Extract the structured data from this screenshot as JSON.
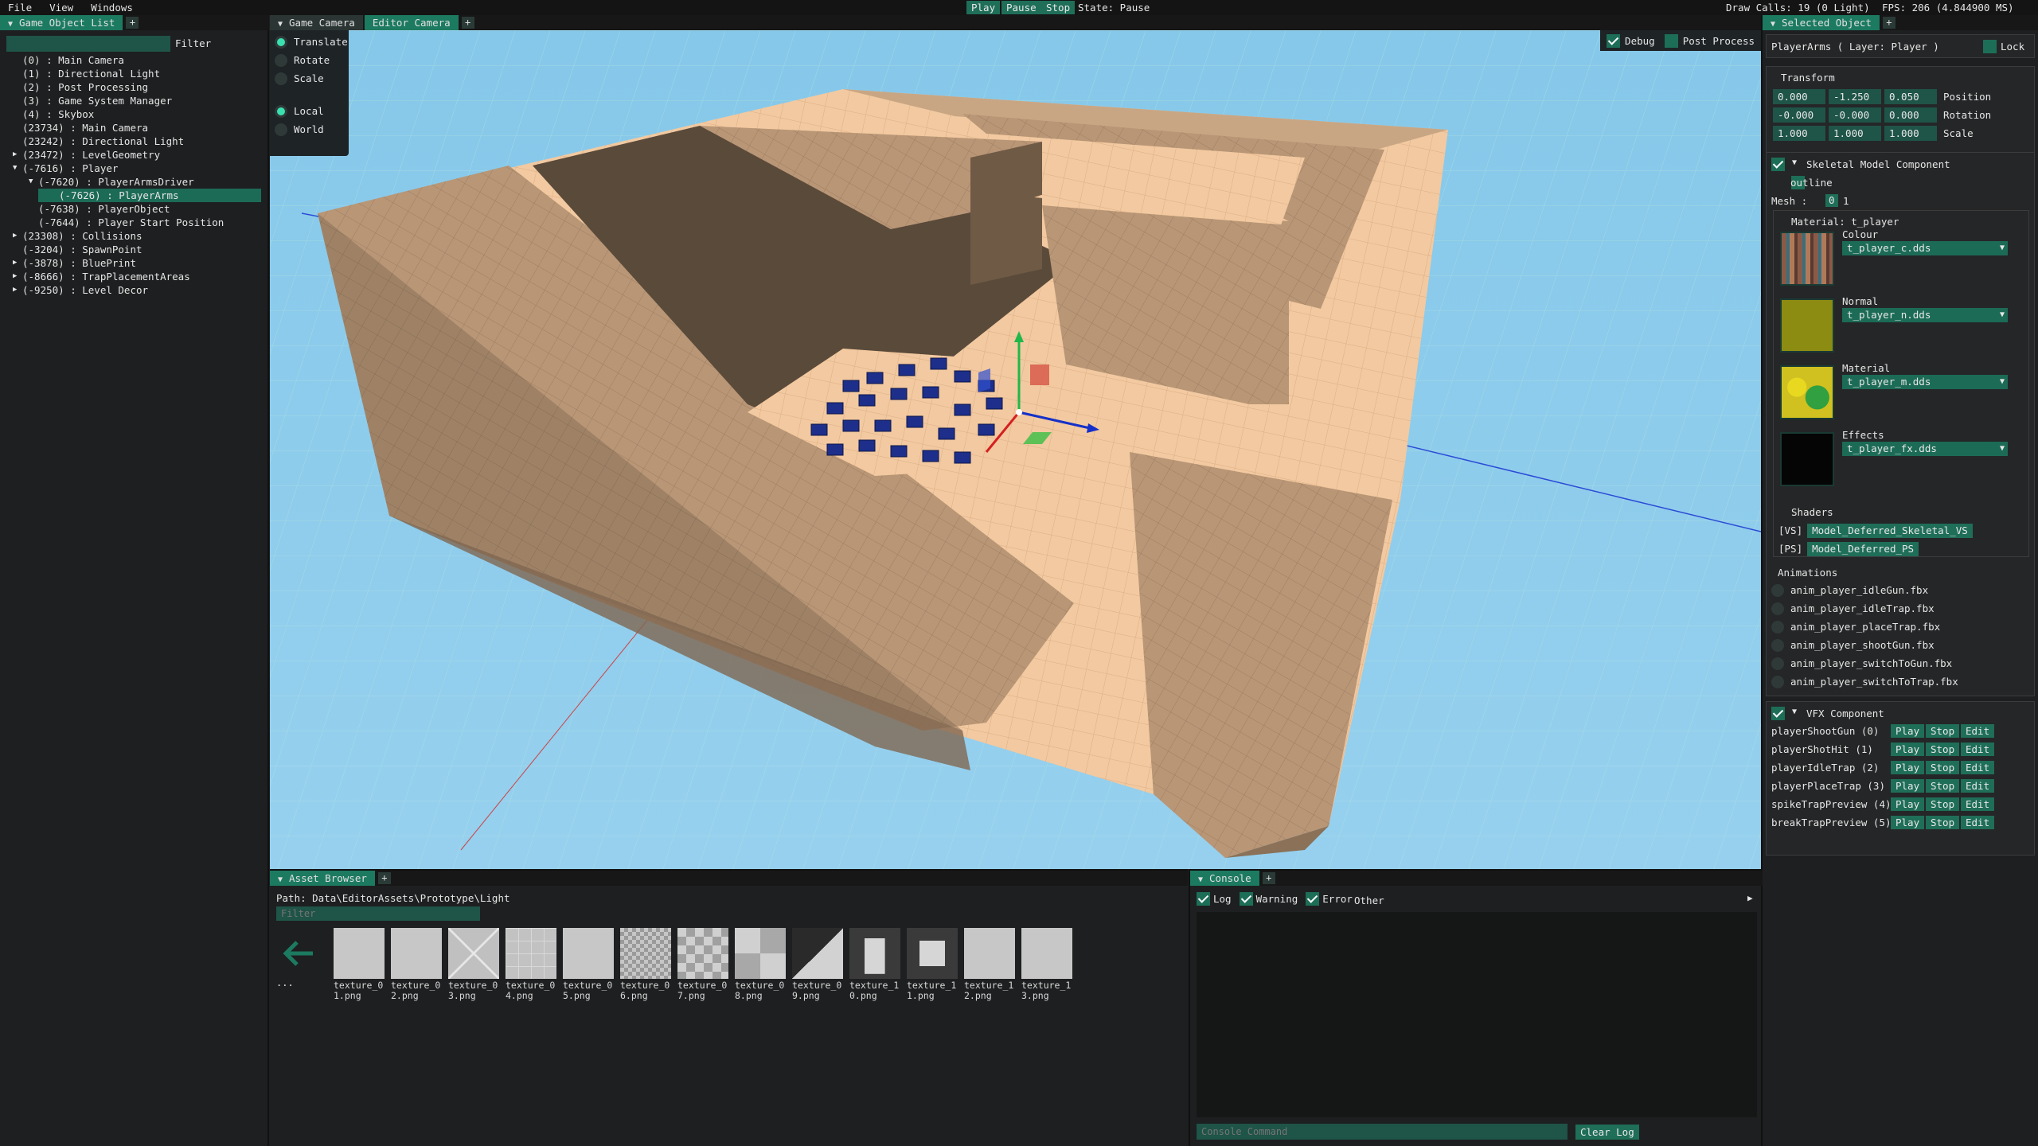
{
  "menubar": {
    "menus": [
      "File",
      "View",
      "Windows"
    ],
    "play": "Play",
    "pause": "Pause",
    "stop": "Stop",
    "state": "State: Pause",
    "draw_calls": "Draw Calls: 19 (0 Light)",
    "fps": "FPS: 206 (4.844900 MS)"
  },
  "hierarchy": {
    "tab": "Game Object List",
    "filter_label": "Filter",
    "filter_value": "",
    "items": [
      {
        "label": "(0) : Main Camera",
        "indent": 0,
        "arrow": ""
      },
      {
        "label": "(1) : Directional Light",
        "indent": 0,
        "arrow": ""
      },
      {
        "label": "(2) : Post Processing",
        "indent": 0,
        "arrow": ""
      },
      {
        "label": "(3) : Game System Manager",
        "indent": 0,
        "arrow": ""
      },
      {
        "label": "(4) : Skybox",
        "indent": 0,
        "arrow": ""
      },
      {
        "label": "(23734) : Main Camera",
        "indent": 0,
        "arrow": ""
      },
      {
        "label": "(23242) : Directional Light",
        "indent": 0,
        "arrow": ""
      },
      {
        "label": "(23472) : LevelGeometry",
        "indent": 0,
        "arrow": "▶"
      },
      {
        "label": "(-7616) : Player",
        "indent": 0,
        "arrow": "▼"
      },
      {
        "label": "(-7620) : PlayerArmsDriver",
        "indent": 1,
        "arrow": "▼"
      },
      {
        "label": "(-7626) : PlayerArms",
        "indent": 2,
        "arrow": "",
        "selected": true
      },
      {
        "label": "(-7638) : PlayerObject",
        "indent": 1,
        "arrow": ""
      },
      {
        "label": "(-7644) : Player Start Position",
        "indent": 1,
        "arrow": ""
      },
      {
        "label": "(23308) : Collisions",
        "indent": 0,
        "arrow": "▶"
      },
      {
        "label": "(-3204) : SpawnPoint",
        "indent": 0,
        "arrow": ""
      },
      {
        "label": "(-3878) : BluePrint",
        "indent": 0,
        "arrow": "▶"
      },
      {
        "label": "(-8666) : TrapPlacementAreas",
        "indent": 0,
        "arrow": "▶"
      },
      {
        "label": "(-9250) : Level Decor",
        "indent": 0,
        "arrow": "▶"
      }
    ]
  },
  "viewport": {
    "tabs": [
      "Game Camera",
      "Editor Camera"
    ],
    "gizmo_modes": [
      "Translate",
      "Rotate",
      "Scale"
    ],
    "gizmo_selected": "Translate",
    "spaces": [
      "Local",
      "World"
    ],
    "space_selected": "Local",
    "debug": "Debug",
    "post_process": "Post Process"
  },
  "inspector": {
    "tab": "Selected Object",
    "object_title": "PlayerArms ( Layer: Player )",
    "lock": "Lock",
    "transform": {
      "heading": "Transform",
      "rows": [
        {
          "label": "Position",
          "values": [
            "0.000",
            "-1.250",
            "0.050"
          ]
        },
        {
          "label": "Rotation",
          "values": [
            "-0.000",
            "-0.000",
            "0.000"
          ]
        },
        {
          "label": "Scale",
          "values": [
            "1.000",
            "1.000",
            "1.000"
          ]
        }
      ]
    },
    "skeletal": {
      "heading": "Skeletal Model Component",
      "outline": "outline",
      "mesh_label": "Mesh :",
      "mesh_values": [
        "0",
        "1"
      ],
      "material_heading": "Material: t_player",
      "slots": [
        {
          "label": "Colour",
          "file": "t_player_c.dds",
          "swatch": "colour"
        },
        {
          "label": "Normal",
          "file": "t_player_n.dds",
          "swatch": "normal"
        },
        {
          "label": "Material",
          "file": "t_player_m.dds",
          "swatch": "material"
        },
        {
          "label": "Effects",
          "file": "t_player_fx.dds",
          "swatch": "effects"
        }
      ],
      "shaders_heading": "Shaders",
      "shaders": [
        {
          "tag": "[VS]",
          "name": "Model_Deferred_Skeletal_VS"
        },
        {
          "tag": "[PS]",
          "name": "Model_Deferred_PS"
        }
      ],
      "animations_heading": "Animations",
      "animations": [
        "anim_player_idleGun.fbx",
        "anim_player_idleTrap.fbx",
        "anim_player_placeTrap.fbx",
        "anim_player_shootGun.fbx",
        "anim_player_switchToGun.fbx",
        "anim_player_switchToTrap.fbx"
      ]
    },
    "vfx": {
      "heading": "VFX Component",
      "play": "Play",
      "stop": "Stop",
      "edit": "Edit",
      "effects": [
        "playerShootGun (0)",
        "playerShotHit (1)",
        "playerIdleTrap (2)",
        "playerPlaceTrap (3)",
        "spikeTrapPreview (4)",
        "breakTrapPreview (5)"
      ]
    }
  },
  "assets": {
    "tab": "Asset Browser",
    "path": "Path: Data\\EditorAssets\\Prototype\\Light",
    "filter_placeholder": "Filter",
    "back_label": "...",
    "files": [
      {
        "line1": "texture_0",
        "line2": "1.png",
        "pattern": "plain"
      },
      {
        "line1": "texture_0",
        "line2": "2.png",
        "pattern": "plain"
      },
      {
        "line1": "texture_0",
        "line2": "3.png",
        "pattern": "cross"
      },
      {
        "line1": "texture_0",
        "line2": "4.png",
        "pattern": "grid"
      },
      {
        "line1": "texture_0",
        "line2": "5.png",
        "pattern": "plain"
      },
      {
        "line1": "texture_0",
        "line2": "6.png",
        "pattern": "checker-small"
      },
      {
        "line1": "texture_0",
        "line2": "7.png",
        "pattern": "checker-mid"
      },
      {
        "line1": "texture_0",
        "line2": "8.png",
        "pattern": "checker-big"
      },
      {
        "line1": "texture_0",
        "line2": "9.png",
        "pattern": "stairs"
      },
      {
        "line1": "texture_1",
        "line2": "0.png",
        "pattern": "door"
      },
      {
        "line1": "texture_1",
        "line2": "1.png",
        "pattern": "window"
      },
      {
        "line1": "texture_1",
        "line2": "2.png",
        "pattern": "plain"
      },
      {
        "line1": "texture_1",
        "line2": "3.png",
        "pattern": "plain"
      }
    ]
  },
  "console": {
    "tab": "Console",
    "filters": [
      {
        "label": "Log",
        "checked": true
      },
      {
        "label": "Warning",
        "checked": true
      },
      {
        "label": "Error",
        "checked": true
      }
    ],
    "other": "Other",
    "command_placeholder": "Console Command",
    "clear": "Clear Log"
  },
  "colors": {
    "accent": "#1c7a61",
    "sky": "#8ecbe9",
    "panel": "#1e1f20"
  }
}
